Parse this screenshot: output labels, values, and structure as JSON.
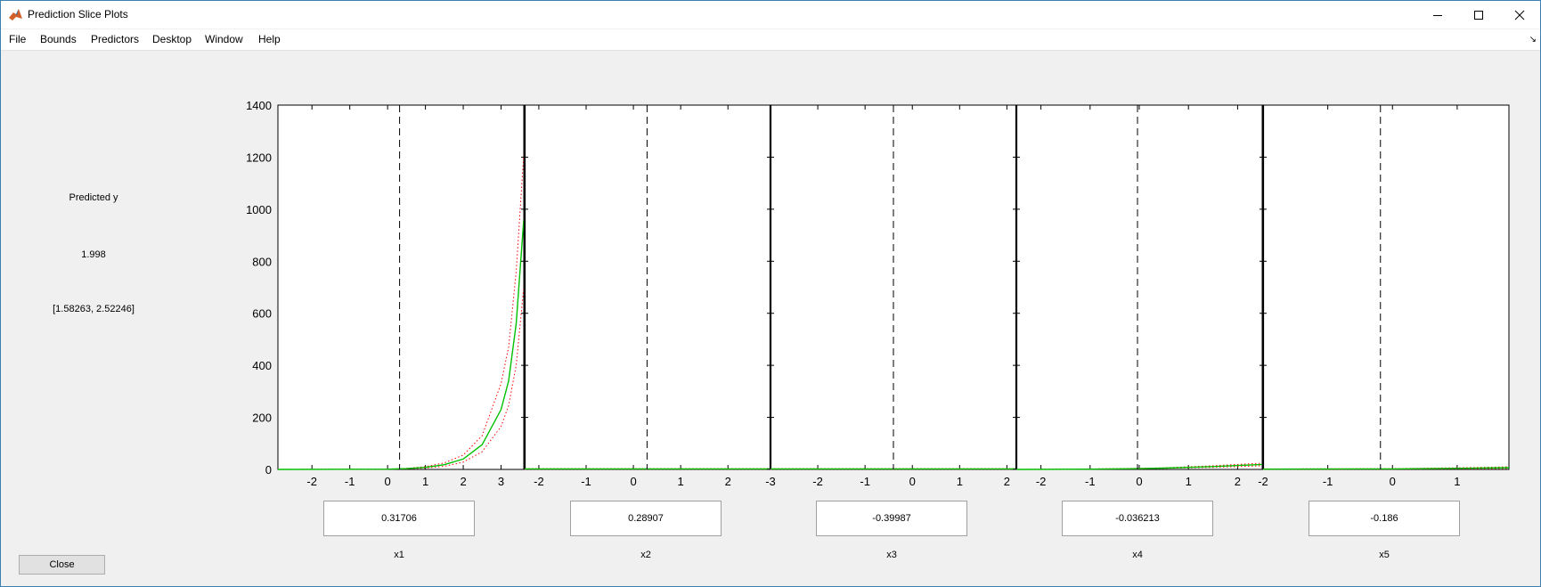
{
  "window": {
    "title": "Prediction Slice Plots",
    "icon": "matlab-icon",
    "controls": [
      "minimize-icon",
      "maximize-icon",
      "close-icon"
    ]
  },
  "menu": [
    "File",
    "Bounds",
    "Predictors",
    "Desktop",
    "Window",
    "Help"
  ],
  "side": {
    "label": "Predicted y",
    "value": "1.998",
    "interval": "[1.58263, 2.52246]",
    "close_label": "Close"
  },
  "colors": {
    "prediction_line": "#00c000",
    "confidence_bounds": "#ff0000",
    "reference_line": "#000000"
  },
  "chart_data": {
    "type": "line",
    "ylim": [
      0,
      1400
    ],
    "y_ticks": [
      "0",
      "200",
      "400",
      "600",
      "800",
      "1000",
      "1200",
      "1400"
    ],
    "panels": [
      {
        "name": "x1",
        "value": "0.31706",
        "xlim": [
          -2.9,
          3.6
        ],
        "x_ticks": [
          "-2",
          "-1",
          "0",
          "1",
          "2",
          "3"
        ],
        "curve": [
          [
            -2.9,
            0
          ],
          [
            0,
            1
          ],
          [
            0.5,
            3
          ],
          [
            1,
            8
          ],
          [
            1.5,
            18
          ],
          [
            2,
            40
          ],
          [
            2.5,
            95
          ],
          [
            3,
            230
          ],
          [
            3.2,
            340
          ],
          [
            3.4,
            560
          ],
          [
            3.6,
            960
          ]
        ],
        "upper": [
          [
            -2.9,
            0
          ],
          [
            0,
            1
          ],
          [
            0.5,
            4
          ],
          [
            1,
            11
          ],
          [
            1.5,
            25
          ],
          [
            2,
            55
          ],
          [
            2.5,
            130
          ],
          [
            3,
            330
          ],
          [
            3.2,
            470
          ],
          [
            3.4,
            760
          ],
          [
            3.6,
            1210
          ]
        ],
        "lower": [
          [
            -2.9,
            0
          ],
          [
            0,
            1
          ],
          [
            0.5,
            2
          ],
          [
            1,
            5
          ],
          [
            1.5,
            12
          ],
          [
            2,
            28
          ],
          [
            2.5,
            68
          ],
          [
            3,
            165
          ],
          [
            3.2,
            245
          ],
          [
            3.4,
            400
          ],
          [
            3.6,
            700
          ]
        ]
      },
      {
        "name": "x2",
        "value": "0.28907",
        "xlim": [
          -2.3,
          2.9
        ],
        "x_ticks": [
          "-2",
          "-1",
          "0",
          "1",
          "2"
        ],
        "curve": [
          [
            -2.3,
            2
          ],
          [
            2.9,
            2
          ]
        ],
        "upper": [
          [
            -2.3,
            3
          ],
          [
            2.9,
            3
          ]
        ],
        "lower": [
          [
            -2.3,
            1
          ],
          [
            2.9,
            1
          ]
        ]
      },
      {
        "name": "x3",
        "value": "-0.39987",
        "xlim": [
          -3.0,
          2.2
        ],
        "x_ticks": [
          "-3",
          "-2",
          "-1",
          "0",
          "1",
          "2"
        ],
        "curve": [
          [
            -3.0,
            2
          ],
          [
            2.2,
            2
          ]
        ],
        "upper": [
          [
            -3.0,
            3
          ],
          [
            2.2,
            3
          ]
        ],
        "lower": [
          [
            -3.0,
            1
          ],
          [
            2.2,
            1
          ]
        ]
      },
      {
        "name": "x4",
        "value": "-0.036213",
        "xlim": [
          -2.5,
          2.5
        ],
        "x_ticks": [
          "-2",
          "-1",
          "0",
          "1",
          "2"
        ],
        "curve": [
          [
            -2.5,
            0
          ],
          [
            -1,
            1
          ],
          [
            0,
            3
          ],
          [
            0.5,
            5
          ],
          [
            1,
            8
          ],
          [
            1.5,
            11
          ],
          [
            2,
            15
          ],
          [
            2.5,
            19
          ]
        ],
        "upper": [
          [
            -2.5,
            0
          ],
          [
            -1,
            2
          ],
          [
            0,
            4
          ],
          [
            0.5,
            6
          ],
          [
            1,
            10
          ],
          [
            1.5,
            14
          ],
          [
            2,
            19
          ],
          [
            2.5,
            24
          ]
        ],
        "lower": [
          [
            -2.5,
            0
          ],
          [
            -1,
            1
          ],
          [
            0,
            2
          ],
          [
            0.5,
            4
          ],
          [
            1,
            6
          ],
          [
            1.5,
            8
          ],
          [
            2,
            11
          ],
          [
            2.5,
            14
          ]
        ]
      },
      {
        "name": "x5",
        "value": "-0.186",
        "xlim": [
          -2.0,
          1.8
        ],
        "x_ticks": [
          "-2",
          "-1",
          "0",
          "1"
        ],
        "curve": [
          [
            -2.0,
            1
          ],
          [
            0,
            2
          ],
          [
            1,
            4
          ],
          [
            1.8,
            7
          ]
        ],
        "upper": [
          [
            -2.0,
            2
          ],
          [
            0,
            3
          ],
          [
            1,
            6
          ],
          [
            1.8,
            10
          ]
        ],
        "lower": [
          [
            -2.0,
            0
          ],
          [
            0,
            1
          ],
          [
            1,
            2
          ],
          [
            1.8,
            4
          ]
        ]
      }
    ]
  }
}
